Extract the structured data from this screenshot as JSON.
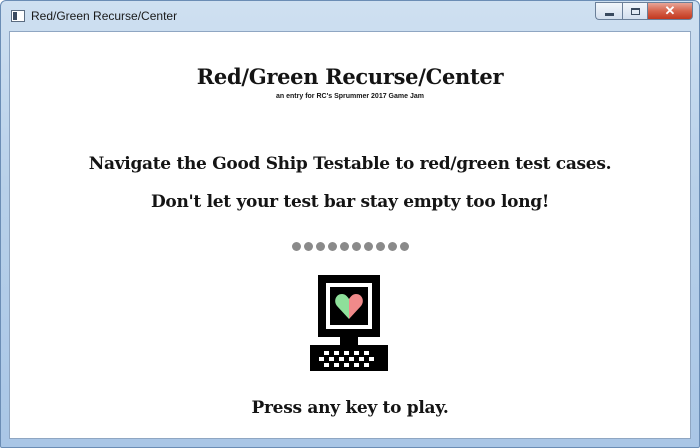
{
  "window": {
    "title": "Red/Green Recurse/Center",
    "icon": "app-window-icon",
    "controls": {
      "minimize": "minimize-icon",
      "maximize": "maximize-icon",
      "close": "close-icon",
      "close_glyph": "✕"
    }
  },
  "game": {
    "title": "Red/Green Recurse/Center",
    "subtitle": "an entry for RC's Sprummer 2017 Game Jam",
    "instruction_1": "Navigate the Good Ship Testable to red/green test cases.",
    "instruction_2": "Don't let your test bar stay empty too long!",
    "test_bar": {
      "filled": 0,
      "total": 10,
      "dot_color": "#8a8a8a"
    },
    "illustration": {
      "icon": "computer-heart-icon",
      "heart_left_color": "#8ee09a",
      "heart_right_color": "#f08a8a"
    },
    "prompt": "Press any key to play."
  }
}
